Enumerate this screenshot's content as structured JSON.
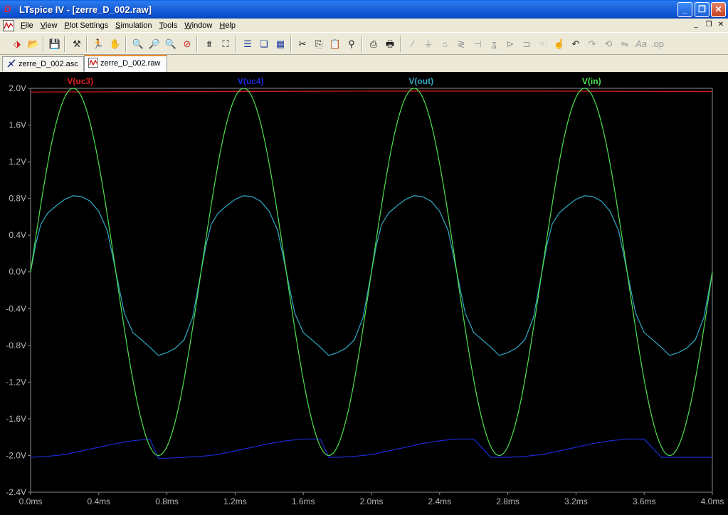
{
  "window": {
    "title": "LTspice IV - [zerre_D_002.raw]",
    "app_icon": "ltspice-logo-icon"
  },
  "menu": [
    "File",
    "View",
    "Plot Settings",
    "Simulation",
    "Tools",
    "Window",
    "Help"
  ],
  "toolbar": {
    "icons": [
      "new-schematic-icon",
      "open-icon",
      "save-icon",
      "control-panel-icon",
      "run-icon",
      "halt-icon",
      "zoom-in-icon",
      "zoom-area-icon",
      "zoom-out-icon",
      "zoom-cancel-icon",
      "autorange-icon",
      "zoom-extents-icon",
      "tile-horizontal-icon",
      "cascade-icon",
      "tile-icon",
      "cut-icon",
      "copy-icon",
      "paste-icon",
      "find-icon",
      "print-preview-icon",
      "print-icon",
      "wire-icon",
      "ground-icon",
      "label-icon",
      "resistor-icon",
      "capacitor-icon",
      "inductor-icon",
      "diode-icon",
      "component-icon",
      "move-icon",
      "drag-icon",
      "undo-icon",
      "redo-icon",
      "rotate-icon",
      "mirror-icon",
      "text-icon",
      "spice-directive-icon"
    ]
  },
  "tabs": [
    {
      "label": "zerre_D_002.asc",
      "icon": "schematic-icon",
      "active": false
    },
    {
      "label": "zerre_D_002.raw",
      "icon": "waveform-icon",
      "active": true
    }
  ],
  "chart_data": {
    "type": "line",
    "title": "",
    "xlabel": "",
    "ylabel": "",
    "xlim": [
      0,
      4.0
    ],
    "ylim": [
      -2.4,
      2.0
    ],
    "x_ticks": [
      "0.0ms",
      "0.4ms",
      "0.8ms",
      "1.2ms",
      "1.6ms",
      "2.0ms",
      "2.4ms",
      "2.8ms",
      "3.2ms",
      "3.6ms",
      "4.0ms"
    ],
    "y_ticks": [
      "2.0V",
      "1.6V",
      "1.2V",
      "0.8V",
      "0.4V",
      "0.0V",
      "-0.4V",
      "-0.8V",
      "-1.2V",
      "-1.6V",
      "-2.0V",
      "-2.4V"
    ],
    "grid": false,
    "background": "#000000",
    "legend_position": "top",
    "series": [
      {
        "name": "V(uc3)",
        "color": "#e02020",
        "x": [
          0.0,
          1.0,
          2.0,
          3.0,
          4.0
        ],
        "y": [
          1.96,
          1.965,
          1.97,
          1.97,
          1.965
        ]
      },
      {
        "name": "V(uc4)",
        "color": "#1c2cd8",
        "x": [
          0.0,
          0.1,
          0.2,
          0.3,
          0.4,
          0.5,
          0.6,
          0.7,
          0.75,
          0.8,
          0.9,
          1.0,
          1.1,
          1.2,
          1.3,
          1.4,
          1.5,
          1.6,
          1.7,
          1.75,
          1.8,
          1.9,
          2.0,
          2.1,
          2.2,
          2.3,
          2.4,
          2.5,
          2.6,
          2.7,
          2.75,
          2.8,
          2.9,
          3.0,
          3.1,
          3.2,
          3.3,
          3.4,
          3.5,
          3.6,
          3.7,
          3.75,
          3.8,
          3.9,
          4.0
        ],
        "y": [
          -2.02,
          -2.01,
          -1.99,
          -1.95,
          -1.91,
          -1.87,
          -1.84,
          -1.82,
          -2.03,
          -2.03,
          -2.02,
          -2.01,
          -1.99,
          -1.95,
          -1.91,
          -1.87,
          -1.84,
          -1.82,
          -1.82,
          -2.02,
          -2.02,
          -2.01,
          -1.99,
          -1.95,
          -1.91,
          -1.87,
          -1.84,
          -1.82,
          -1.82,
          -2.02,
          -2.02,
          -2.02,
          -2.01,
          -1.99,
          -1.95,
          -1.91,
          -1.87,
          -1.84,
          -1.82,
          -1.82,
          -2.02,
          -2.02,
          -2.02,
          -2.02,
          -2.02
        ]
      },
      {
        "name": "V(out)",
        "color": "#32a8c4",
        "x": [
          0.0,
          0.03,
          0.06,
          0.1,
          0.15,
          0.2,
          0.25,
          0.3,
          0.35,
          0.4,
          0.45,
          0.5,
          0.55,
          0.6,
          0.65,
          0.7,
          0.75,
          0.8,
          0.85,
          0.9,
          0.95,
          1.0
        ],
        "y": [
          0.0,
          0.3,
          0.52,
          0.64,
          0.72,
          0.79,
          0.83,
          0.82,
          0.77,
          0.66,
          0.45,
          0.0,
          -0.45,
          -0.66,
          -0.74,
          -0.82,
          -0.91,
          -0.88,
          -0.83,
          -0.74,
          -0.5,
          0.0
        ],
        "periodic": 1.0
      },
      {
        "name": "V(in)",
        "color": "#4ee04e",
        "function": "2*sin(2*pi*x)",
        "amplitude": 2.0,
        "period": 1.0
      }
    ]
  }
}
